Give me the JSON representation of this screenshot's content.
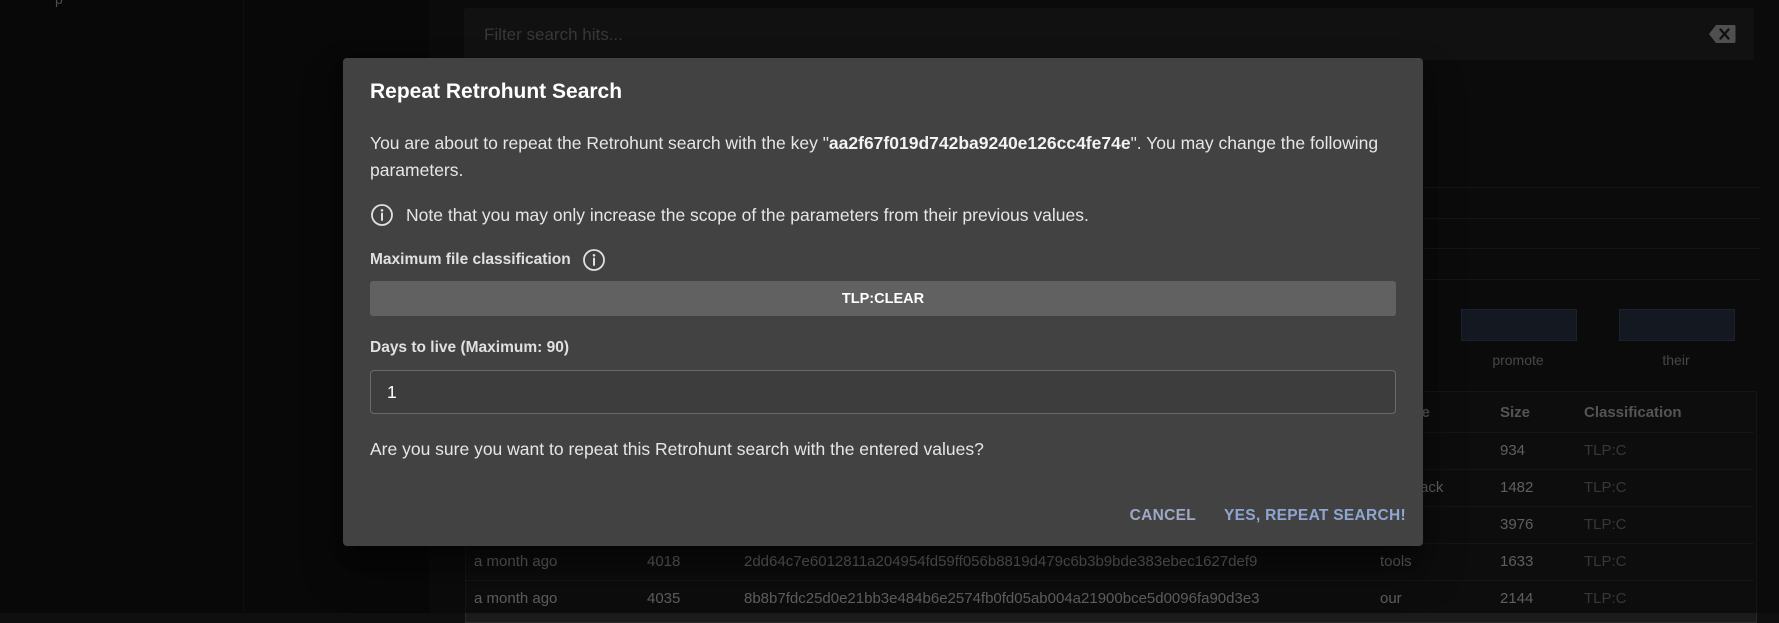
{
  "background": {
    "nav_text": "p",
    "filter_placeholder": "Filter search hits...",
    "chart_labels": [
      "promote",
      "their"
    ],
    "table": {
      "headers": [
        "ype",
        "Size",
        "Classification"
      ],
      "rows": [
        {
          "time": "",
          "count": "",
          "hash": "",
          "type": "",
          "size": "934",
          "classification": "TLP:C"
        },
        {
          "time": "",
          "count": "",
          "hash": "",
          "type": "ack",
          "size": "1482",
          "classification": "TLP:C"
        },
        {
          "time": "",
          "count": "",
          "hash": "",
          "type": "",
          "size": "3976",
          "classification": "TLP:C"
        },
        {
          "time": "a month ago",
          "count": "4018",
          "hash": "2dd64c7e6012811a204954fd59ff056b8819d479c6b3b9bde383ebec1627def9",
          "type": "tools",
          "size": "1633",
          "classification": "TLP:C"
        },
        {
          "time": "a month ago",
          "count": "4035",
          "hash": "8b8b7fdc25d0e21bb3e484b6e2574fb0fd05ab004a21900bce5d0096fa90d3e3",
          "type": "our",
          "size": "2144",
          "classification": "TLP:C"
        }
      ]
    }
  },
  "dialog": {
    "title": "Repeat Retrohunt Search",
    "intro_prefix": "You are about to repeat the Retrohunt search with the key \"",
    "key": "aa2f67f019d742ba9240e126cc4fe74e",
    "intro_suffix": "\". You may change the following parameters.",
    "note": "Note that you may only increase the scope of the parameters from their previous values.",
    "classification_label": "Maximum file classification",
    "classification_value": "TLP:CLEAR",
    "days_label": "Days to live (Maximum: 90)",
    "days_value": "1",
    "confirm_question": "Are you sure you want to repeat this Retrohunt search with the entered values?",
    "cancel_label": "CANCEL",
    "confirm_label": "YES, REPEAT SEARCH!"
  }
}
